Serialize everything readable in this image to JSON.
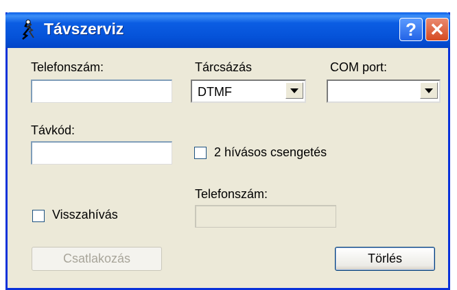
{
  "window": {
    "title": "Távszerviz"
  },
  "fields": {
    "phone_label": "Telefonszám:",
    "dialing_label": "Tárcsázás",
    "dialing_value": "DTMF",
    "com_label": "COM port:",
    "com_value": "",
    "remote_code_label": "Távkód:",
    "two_call_ring_label": "2 hívásos csengetés",
    "callback_phone_label": "Telefonszám:",
    "callback_label": "Visszahívás"
  },
  "buttons": {
    "connect": "Csatlakozás",
    "delete": "Törlés"
  },
  "icons": {
    "help": "help-icon",
    "close": "close-icon",
    "app": "app-icon"
  }
}
